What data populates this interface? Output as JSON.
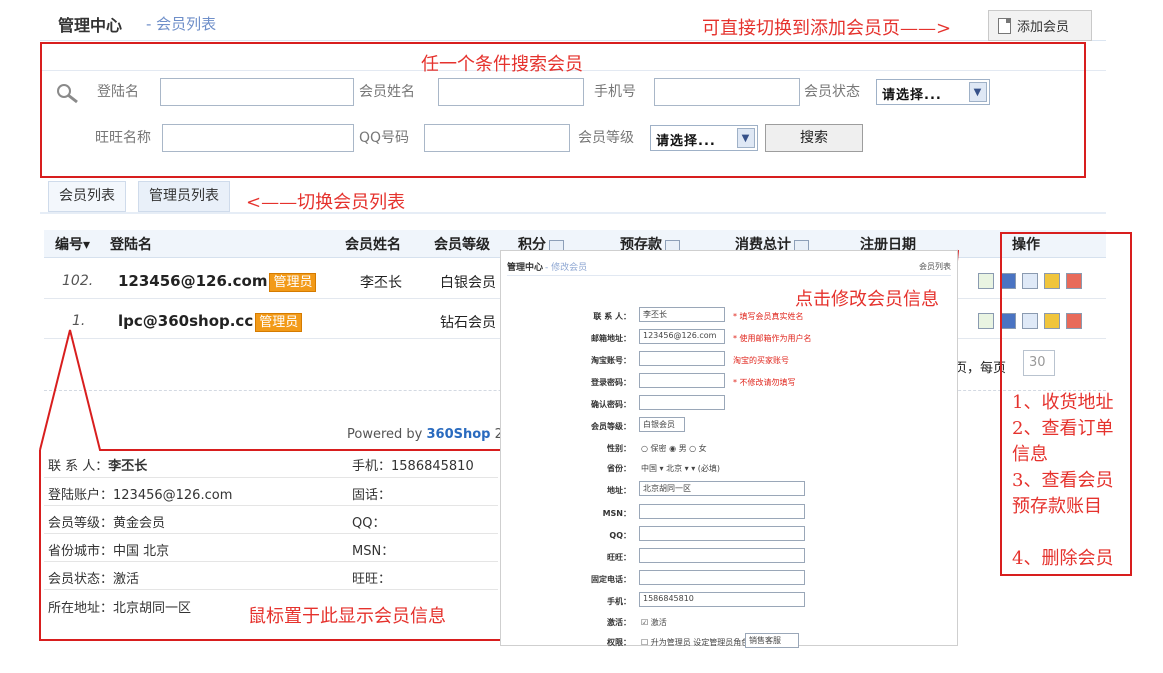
{
  "header": {
    "title": "管理中心",
    "subtitle": "- 会员列表",
    "add_button": "添加会员"
  },
  "search": {
    "login_label": "登陆名",
    "name_label": "会员姓名",
    "phone_label": "手机号",
    "status_label": "会员状态",
    "status_value": "请选择...",
    "wangwang_label": "旺旺名称",
    "qq_label": "QQ号码",
    "level_label": "会员等级",
    "level_value": "请选择...",
    "search_button": "搜索"
  },
  "tabs": [
    "会员列表",
    "管理员列表"
  ],
  "table": {
    "headers": [
      "编号▾",
      "登陆名",
      "会员姓名",
      "会员等级",
      "积分",
      "预存款",
      "消费总计",
      "注册日期",
      "操作"
    ],
    "rows": [
      {
        "id": "102.",
        "email": "123456@126.com",
        "badge": "管理员",
        "name": "李丕长",
        "level": "白银会员"
      },
      {
        "id": "1.",
        "email": "lpc@360shop.cc",
        "badge": "管理员",
        "name": "",
        "level": "钻石会员"
      }
    ],
    "pager_tail": "页，每页",
    "page_size": "30"
  },
  "footer": {
    "powered": "Powered by",
    "brand": "360Shop",
    "brand_tail": " 2"
  },
  "member_info": {
    "contact_label": "联 系 人：",
    "contact": "李丕长",
    "mobile_label": "手机：",
    "mobile": "1586845810",
    "account_label": "登陆账户：",
    "account": "123456@126.com",
    "phone_label": "固话：",
    "phone": "",
    "level_label": "会员等级：",
    "level": "黄金会员",
    "qq_label": "QQ：",
    "qq": "",
    "city_label": "省份城市：",
    "city": "中国 北京",
    "msn_label": "MSN：",
    "msn": "",
    "status_label": "会员状态：",
    "status": "激活",
    "ww_label": "旺旺：",
    "ww": "",
    "addr_label": "所在地址：",
    "addr": "北京胡同一区"
  },
  "edit_form": {
    "title": "管理中心",
    "subtitle": "- 修改会员",
    "link": "会员列表",
    "contact_label": "联 系 人：",
    "contact": "李丕长",
    "contact_note": "* 填写会员真实姓名",
    "email_label": "邮箱地址：",
    "email": "123456@126.com",
    "email_note": "* 使用邮箱作为用户名",
    "taobao_label": "淘宝账号：",
    "taobao_note": "淘宝的买家账号",
    "pwd_label": "登录密码：",
    "pwd_note": "* 不修改请勿填写",
    "pwd2_label": "确认密码：",
    "level_label": "会员等级：",
    "level": "白银会员",
    "gender_label": "性别：",
    "gender_opts": "○ 保密 ◉ 男 ○ 女",
    "province_label": "省份：",
    "province": "中国 ▾ 北京 ▾  ▾ (必填)",
    "addr_label": "地址：",
    "addr": "北京胡同一区",
    "msn_label": "MSN：",
    "qq_label": "QQ：",
    "ww_label": "旺旺：",
    "phone_label": "固定电话：",
    "mobile_label": "手机：",
    "mobile": "1586845810",
    "active_label": "激活：",
    "active": "☑ 激活",
    "perm_label": "权限：",
    "perm": "☐ 升为管理员  设定管理员角色",
    "perm_role": "销售客服"
  },
  "annotations": {
    "add": "可直接切换到添加会员页——>",
    "search": "任一个条件搜索会员",
    "tabs": "<——切换会员列表",
    "edit": "点击修改会员信息",
    "ops": [
      "1、收货地址",
      "2、查看订单",
      "信息",
      "3、查看会员",
      "预存款账目",
      "4、删除会员"
    ],
    "hover": "鼠标置于此显示会员信息"
  },
  "colors": {
    "annotation": "#e5322d",
    "badge": "#f29a18",
    "brand": "#2a6bbf"
  }
}
